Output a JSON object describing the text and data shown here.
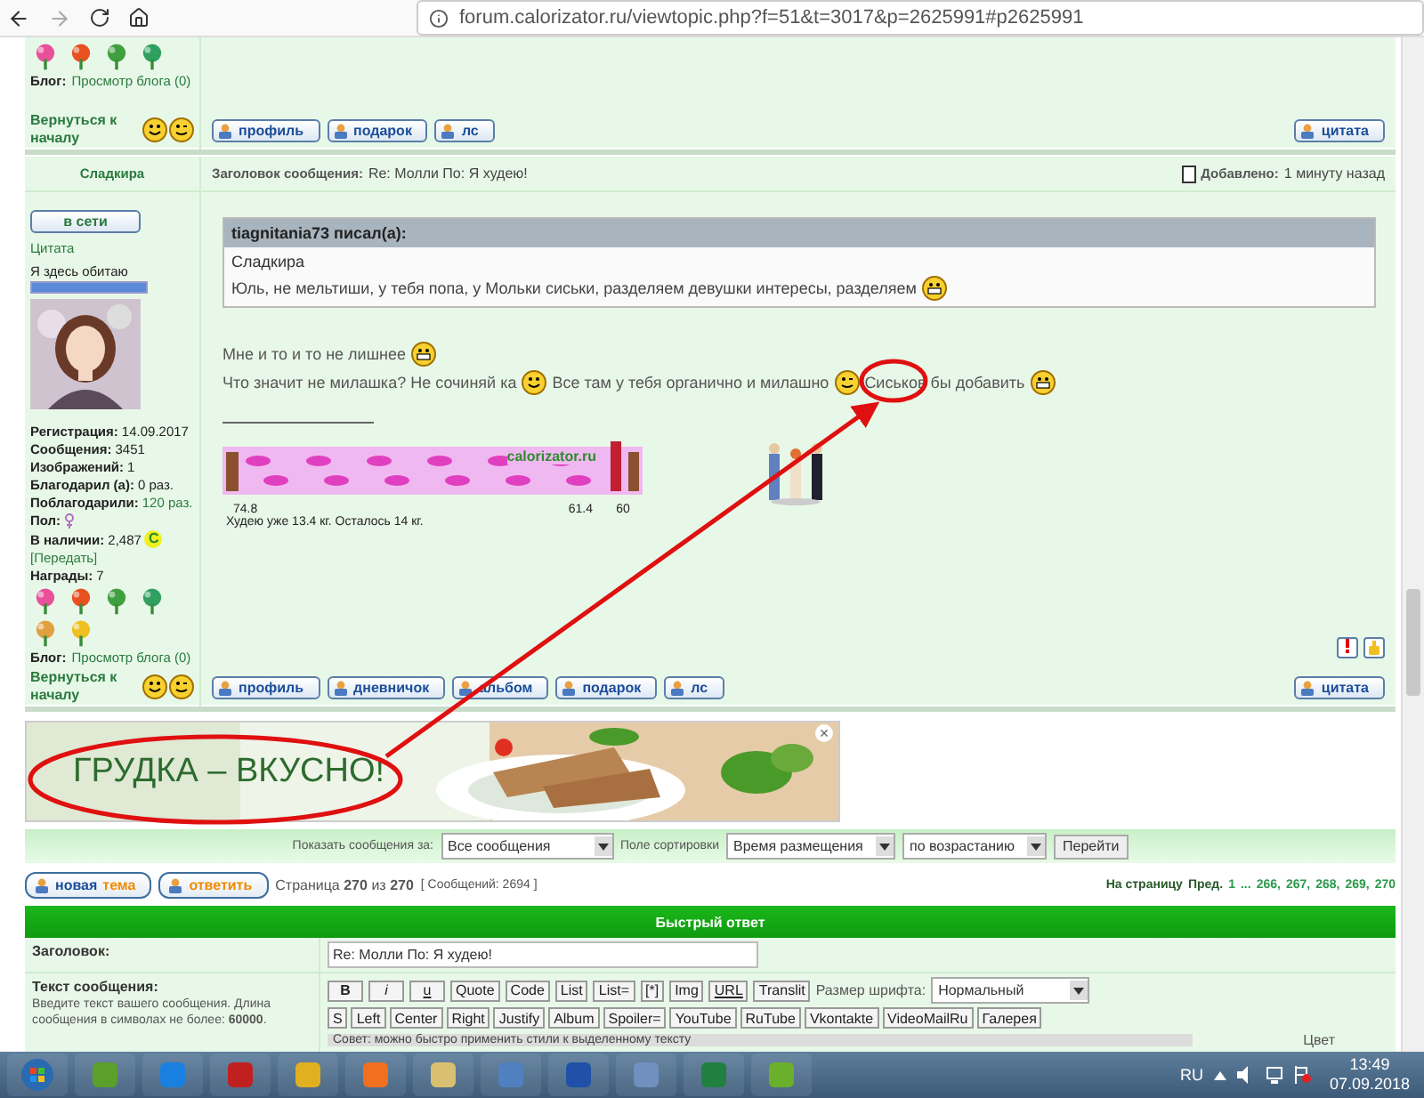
{
  "browser": {
    "url": "forum.calorizator.ru/viewtopic.php?f=51&t=3017&p=2625991#p2625991"
  },
  "prev_post": {
    "blog_label": "Блог:",
    "blog_link": "Просмотр блога (0)",
    "back_link": "Вернуться к началу",
    "buttons": [
      "профиль",
      "подарок",
      "лс"
    ],
    "quote_button": "цитата"
  },
  "post": {
    "author": "Сладкира",
    "subject_label": "Заголовок сообщения:",
    "subject": "Re: Молли По: Я худею!",
    "added_label": "Добавлено:",
    "added": "1 минуту назад",
    "status_button": "в сети",
    "rank_link": "Цитата",
    "rank": {
      "title": "Я здесь обитаю",
      "level": 1
    },
    "stats": [
      {
        "label": "Регистрация:",
        "value": "14.09.2017",
        "kind": "text"
      },
      {
        "label": "Сообщения:",
        "value": "3451",
        "kind": "text"
      },
      {
        "label": "Изображений:",
        "value": "1",
        "kind": "text"
      },
      {
        "label": "Благодарил (а):",
        "value": "0 раз.",
        "kind": "text"
      },
      {
        "label": "Поблагодарили:",
        "value": "120 раз.",
        "kind": "link"
      },
      {
        "label": "Пол:",
        "kind": "gender"
      },
      {
        "label": "В наличии:",
        "value": "2,487",
        "coin": "C",
        "kind": "coins"
      }
    ],
    "transfer_link": "[Передать]",
    "awards_label": "Награды:",
    "awards_count": "7",
    "blog_label": "Блог:",
    "blog_link": "Просмотр блога (0)",
    "quote": {
      "header": "tiagnitania73 писал(а):",
      "author": "Сладкира",
      "text": "Юль, не мельтиши, у тебя попа, у Мольки сиськи, разделяем девушки интересы, разделяем"
    },
    "message": [
      [
        {
          "kind": "text",
          "text": "Мне и то и то не лишнее"
        },
        {
          "kind": "grin"
        }
      ],
      [
        {
          "kind": "text",
          "text": "Что значит не милашка? Не сочиняй ка"
        },
        {
          "kind": "smile"
        },
        {
          "kind": "text",
          "text": "Все там у тебя органично и милашно"
        },
        {
          "kind": "wink"
        },
        {
          "kind": "text",
          "text": "Сиськов бы добавить"
        },
        {
          "kind": "grin"
        }
      ]
    ],
    "ticker": {
      "site": "calorizator.ru",
      "start": "74.8",
      "current": "61.4",
      "goal": "60",
      "caption": "Худею уже 13.4 кг. Осталось 14 кг."
    },
    "back_link": "Вернуться к началу",
    "buttons": [
      "профиль",
      "дневничок",
      "альбом",
      "подарок",
      "лс"
    ],
    "quote_button": "цитата"
  },
  "ad": {
    "headline": "ГРУДКА – ВКУСНО!",
    "close": "×"
  },
  "sort_bar": {
    "show_label": "Показать сообщения за:",
    "show_value": "Все сообщения",
    "sort_label": "Поле сортировки",
    "sort_value": "Время размещения",
    "order_value": "по возрастанию",
    "go_button": "Перейти"
  },
  "pagination": {
    "new_topic_a": "новая",
    "new_topic_b": "тема",
    "reply": "ответить",
    "page_info": "Страница **270** из **270**",
    "count": "[ Сообщений: 2694 ]",
    "goto_label": "На страницу",
    "prev": "Пред.",
    "pages": [
      "1",
      "...",
      "266,",
      "267,",
      "268,",
      "269,",
      "270"
    ]
  },
  "quick_reply": {
    "title": "Быстрый ответ",
    "subject_label": "Заголовок:",
    "subject_value": "Re: Молли По: Я худею!",
    "text_label": "Текст сообщения:",
    "text_hint": "Введите текст вашего сообщения. Длина сообщения в символах не более: **60000**.",
    "tools_row1": [
      "B",
      "i",
      "u",
      "Quote",
      "Code",
      "List",
      "List=",
      "[*]",
      "Img",
      "URL",
      "Translit"
    ],
    "font_size_label": "Размер шрифта:",
    "font_size_value": "Нормальный",
    "tools_row2": [
      "S",
      "Left",
      "Center",
      "Right",
      "Justify",
      "Album",
      "Spoiler=",
      "YouTube",
      "RuTube",
      "Vkontakte",
      "VideoMailRu",
      "Галерея"
    ],
    "tip": "Совет: можно быстро применить стили к выделенному тексту",
    "color_label": "Цвет"
  },
  "taskbar": {
    "language": "RU",
    "time": "13:49",
    "date": "07.09.2018"
  }
}
